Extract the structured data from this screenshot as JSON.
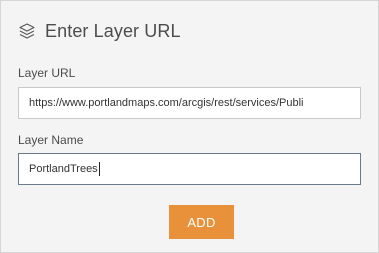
{
  "header": {
    "icon": "layers-icon",
    "title": "Enter Layer URL"
  },
  "layer_url": {
    "label": "Layer URL",
    "value": "https://www.portlandmaps.com/arcgis/rest/services/Publi"
  },
  "layer_name": {
    "label": "Layer Name",
    "value": "PortlandTrees"
  },
  "add_button": {
    "label": "ADD",
    "color": "#e8913a"
  }
}
